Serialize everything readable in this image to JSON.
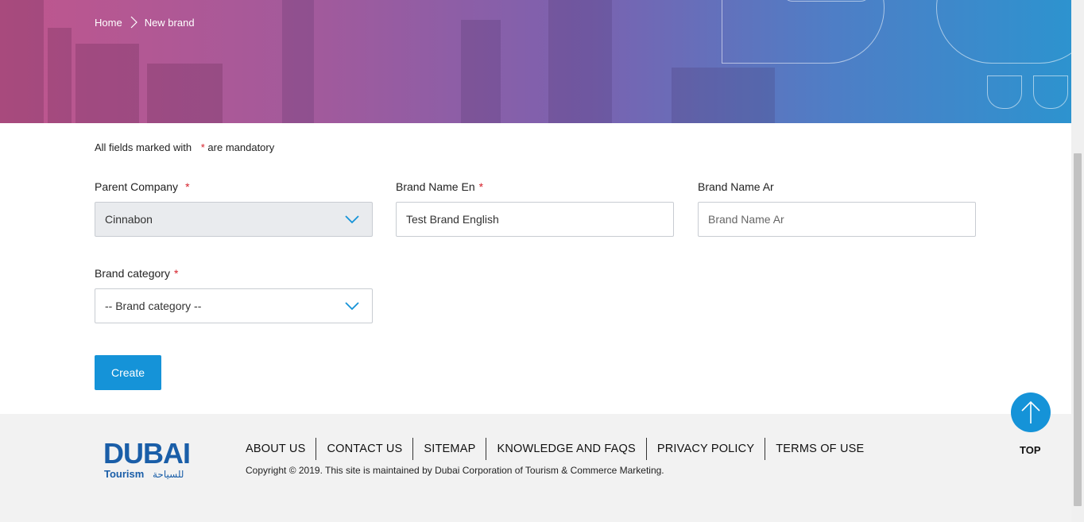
{
  "breadcrumb": {
    "home": "Home",
    "current": "New brand"
  },
  "form": {
    "mandatory_prefix": "All fields marked with",
    "mandatory_star": "*",
    "mandatory_suffix": "are mandatory",
    "parent_company": {
      "label": "Parent Company",
      "star": "*",
      "value": "Cinnabon"
    },
    "brand_name_en": {
      "label": "Brand Name En",
      "star": "*",
      "value": "Test Brand English"
    },
    "brand_name_ar": {
      "label": "Brand Name Ar",
      "placeholder": "Brand Name Ar"
    },
    "brand_category": {
      "label": "Brand category",
      "star": "*",
      "value": "-- Brand category --"
    },
    "create_label": "Create"
  },
  "footer": {
    "logo_text": "DUBAI",
    "logo_sub": "Tourism",
    "logo_arabic": "للسياحة",
    "links": [
      "ABOUT US",
      "CONTACT US",
      "SITEMAP",
      "KNOWLEDGE AND FAQS",
      "PRIVACY POLICY",
      "TERMS OF USE"
    ],
    "copyright": "Copyright © 2019. This site is maintained by Dubai Corporation of Tourism & Commerce Marketing."
  },
  "top_label": "TOP",
  "colors": {
    "accent": "#1593d8",
    "required": "#d6202a",
    "footer_bg": "#f2f2f2"
  },
  "icons": [
    "chevron-right-icon",
    "chevron-down-icon",
    "arrow-up-icon"
  ]
}
